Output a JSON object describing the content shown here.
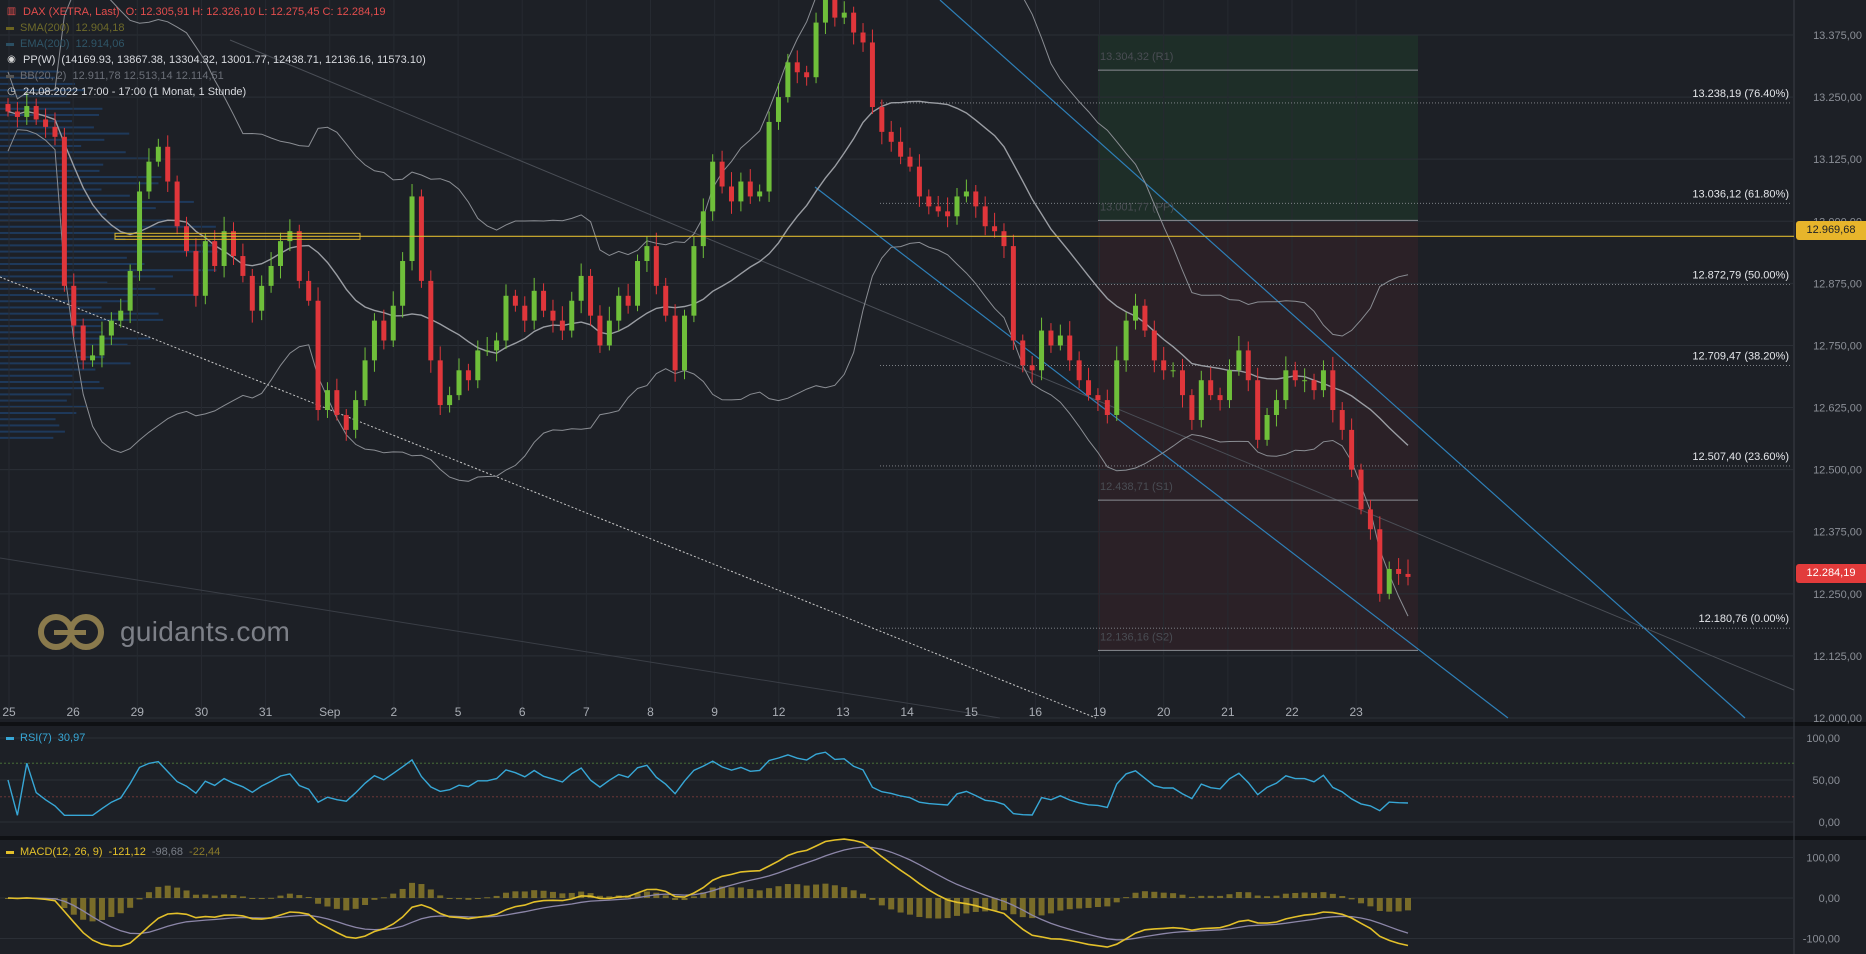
{
  "header": {
    "symbol": "DAX (XETRA, Last)",
    "ohlc": "O: 12.305,91  H: 12.326,10  L: 12.275,45  C: 12.284,19",
    "sma_label": "SMA(200)",
    "sma_value": "12.904,18",
    "ema_label": "EMA(200)",
    "ema_value": "12.914,06",
    "pp_label": "PP(W)",
    "pp_values": "(14169.93, 13867.38, 13304.32, 13001.77, 12438.71, 12136.16, 11573.10)",
    "bb_label": "BB(20, 2)",
    "bb_values": "12.911,78  12.513,14  12.114,51",
    "time_range": "24.08.2022 17:00 - 17:00   (1 Monat, 1 Stunde)",
    "icons": [
      "bars-icon",
      "pivot-icon",
      "clock-icon"
    ]
  },
  "logo": {
    "text": "guidants.com"
  },
  "colors": {
    "background": "#1d2026",
    "up": "#6fbf3a",
    "down": "#e0363b",
    "bollinger": "#8a8d93",
    "pp_line": "#d9b52f",
    "channel": "#2e7fb7",
    "rsi": "#37a7d6",
    "macd": "#e3c02a",
    "signal": "#8c86a8",
    "hist": "#8a7a2a"
  },
  "chart_data": [
    {
      "type": "candlestick",
      "title": "DAX (XETRA, Last)",
      "x_ticks": [
        "25",
        "26",
        "29",
        "30",
        "31",
        "Sep",
        "2",
        "5",
        "6",
        "7",
        "8",
        "9",
        "12",
        "13",
        "14",
        "15",
        "16",
        "19",
        "20",
        "21",
        "22",
        "23"
      ],
      "y_ticks": [
        "13.375,00",
        "13.250,00",
        "13.125,00",
        "13.000,00",
        "12.875,00",
        "12.750,00",
        "12.625,00",
        "12.500,00",
        "12.375,00",
        "12.250,00",
        "12.125,00",
        "12.000,00"
      ],
      "ylim": [
        12000,
        13375
      ],
      "last_price": "12.284,19",
      "pp_weekly_price": "12.969,68",
      "fibonacci": [
        {
          "label": "13.238,19 (76.40%)",
          "value": 13238.19
        },
        {
          "label": "13.036,12 (61.80%)",
          "value": 13036.12
        },
        {
          "label": "12.872,79 (50.00%)",
          "value": 12872.79
        },
        {
          "label": "12.709,47 (38.20%)",
          "value": 12709.47
        },
        {
          "label": "12.507,40 (23.60%)",
          "value": 12507.4
        },
        {
          "label": "12.180,76 (0.00%)",
          "value": 12180.76
        }
      ],
      "pivots": [
        {
          "label": "13.304,32 (R1)",
          "value": 13304.32
        },
        {
          "label": "13.001,77 (PP)",
          "value": 13001.77
        },
        {
          "label": "12.438,71 (S1)",
          "value": 12438.71
        },
        {
          "label": "12.136,16 (S2)",
          "value": 12136.16
        }
      ],
      "closes": [
        13221,
        13210,
        13232,
        13205,
        13190,
        13170,
        12870,
        12790,
        12720,
        12730,
        12770,
        12800,
        12820,
        12900,
        13060,
        13120,
        13150,
        13080,
        12990,
        12940,
        12850,
        12960,
        12910,
        12980,
        12930,
        12890,
        12820,
        12870,
        12910,
        12960,
        12980,
        12880,
        12840,
        12620,
        12660,
        12610,
        12580,
        12640,
        12720,
        12800,
        12760,
        12830,
        12920,
        13050,
        12880,
        12720,
        12630,
        12650,
        12700,
        12680,
        12740,
        12740,
        12760,
        12850,
        12830,
        12800,
        12860,
        12820,
        12800,
        12780,
        12840,
        12890,
        12810,
        12750,
        12800,
        12850,
        12830,
        12920,
        12950,
        12870,
        12810,
        12700,
        12810,
        12950,
        13020,
        13120,
        13070,
        13040,
        13080,
        13050,
        13060,
        13200,
        13250,
        13320,
        13300,
        13290,
        13400,
        13450,
        13410,
        13420,
        13380,
        13360,
        13230,
        13180,
        13160,
        13130,
        13110,
        13050,
        13030,
        13020,
        13010,
        13050,
        13060,
        13030,
        12990,
        12980,
        12950,
        12760,
        12710,
        12700,
        12780,
        12750,
        12770,
        12720,
        12680,
        12650,
        12640,
        12610,
        12720,
        12800,
        12830,
        12780,
        12720,
        12700,
        12700,
        12650,
        12600,
        12680,
        12650,
        12640,
        12700,
        12740,
        12680,
        12560,
        12610,
        12640,
        12700,
        12680,
        12680,
        12660,
        12700,
        12620,
        12580,
        12500,
        12420,
        12380,
        12250,
        12300,
        12290,
        12284
      ],
      "volume_profile": "horizontal volume-at-price histogram on the left side"
    },
    {
      "type": "line",
      "name": "RSI(7)",
      "label": "RSI(7)",
      "value_label": "30,97",
      "y_ticks": [
        "100,00",
        "50,00",
        "0,00"
      ],
      "ylim": [
        0,
        100
      ],
      "levels": [
        70,
        30
      ]
    },
    {
      "type": "line",
      "name": "MACD(12, 26, 9)",
      "label": "MACD(12, 26, 9)",
      "values_label": "-121,12",
      "signal_label": "-98,68",
      "hist_label": "-22,44",
      "y_ticks": [
        "100,00",
        "0,00",
        "-100,00"
      ],
      "ylim": [
        -140,
        140
      ]
    }
  ]
}
